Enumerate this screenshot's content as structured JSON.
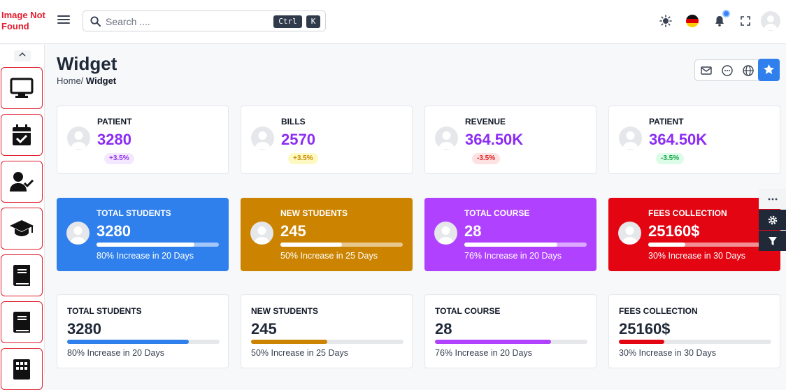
{
  "logo_alt": "Image Not Found",
  "search": {
    "placeholder": "Search ....",
    "shortcut_ctrl": "Ctrl",
    "shortcut_key": "K"
  },
  "page": {
    "title": "Widget",
    "breadcrumb_home": "Home/",
    "breadcrumb_current": "Widget"
  },
  "stats": [
    {
      "label": "PATIENT",
      "value": "3280",
      "badge": "+3.5%",
      "badge_bg": "#f3e8ff",
      "badge_color": "#9333ea"
    },
    {
      "label": "BILLS",
      "value": "2570",
      "badge": "+3.5%",
      "badge_bg": "#fef9c3",
      "badge_color": "#ca8a04"
    },
    {
      "label": "REVENUE",
      "value": "364.50K",
      "badge": "-3.5%",
      "badge_bg": "#fee2e2",
      "badge_color": "#dc2626"
    },
    {
      "label": "PATIENT",
      "value": "364.50K",
      "badge": "-3.5%",
      "badge_bg": "#dcfce7",
      "badge_color": "#16a34a"
    }
  ],
  "value_color": "#8b2cf5",
  "colored_cards": [
    {
      "label": "TOTAL STUDENTS",
      "value": "3280",
      "progress": 0.8,
      "caption": "80% Increase in 20 Days",
      "bg": "#2f80ed"
    },
    {
      "label": "NEW STUDENTS",
      "value": "245",
      "progress": 0.5,
      "caption": "50% Increase in 25 Days",
      "bg": "#cc8400"
    },
    {
      "label": "TOTAL COURSE",
      "value": "28",
      "progress": 0.76,
      "caption": "76% Increase in 20 Days",
      "bg": "#b042ff"
    },
    {
      "label": "FEES COLLECTION",
      "value": "25160$",
      "progress": 0.3,
      "caption": "30% Increase in 30 Days",
      "bg": "#e30512"
    }
  ],
  "plain_cards": [
    {
      "label": "TOTAL STUDENTS",
      "value": "3280",
      "progress": 0.8,
      "caption": "80% Increase in 20 Days",
      "bar": "#2f80ed"
    },
    {
      "label": "NEW STUDENTS",
      "value": "245",
      "progress": 0.5,
      "caption": "50% Increase in 25 Days",
      "bar": "#cc8400"
    },
    {
      "label": "TOTAL COURSE",
      "value": "28",
      "progress": 0.76,
      "caption": "76% Increase in 20 Days",
      "bar": "#b042ff"
    },
    {
      "label": "FEES COLLECTION",
      "value": "25160$",
      "progress": 0.3,
      "caption": "30% Increase in 30 Days",
      "bar": "#e30512"
    }
  ],
  "sidebar_icons": [
    "monitor-icon",
    "calendar-check-icon",
    "user-check-icon",
    "graduation-cap-icon",
    "book-icon",
    "book-icon",
    "building-icon"
  ],
  "right_tools": [
    "more-icon",
    "gear-icon",
    "filter-icon"
  ]
}
